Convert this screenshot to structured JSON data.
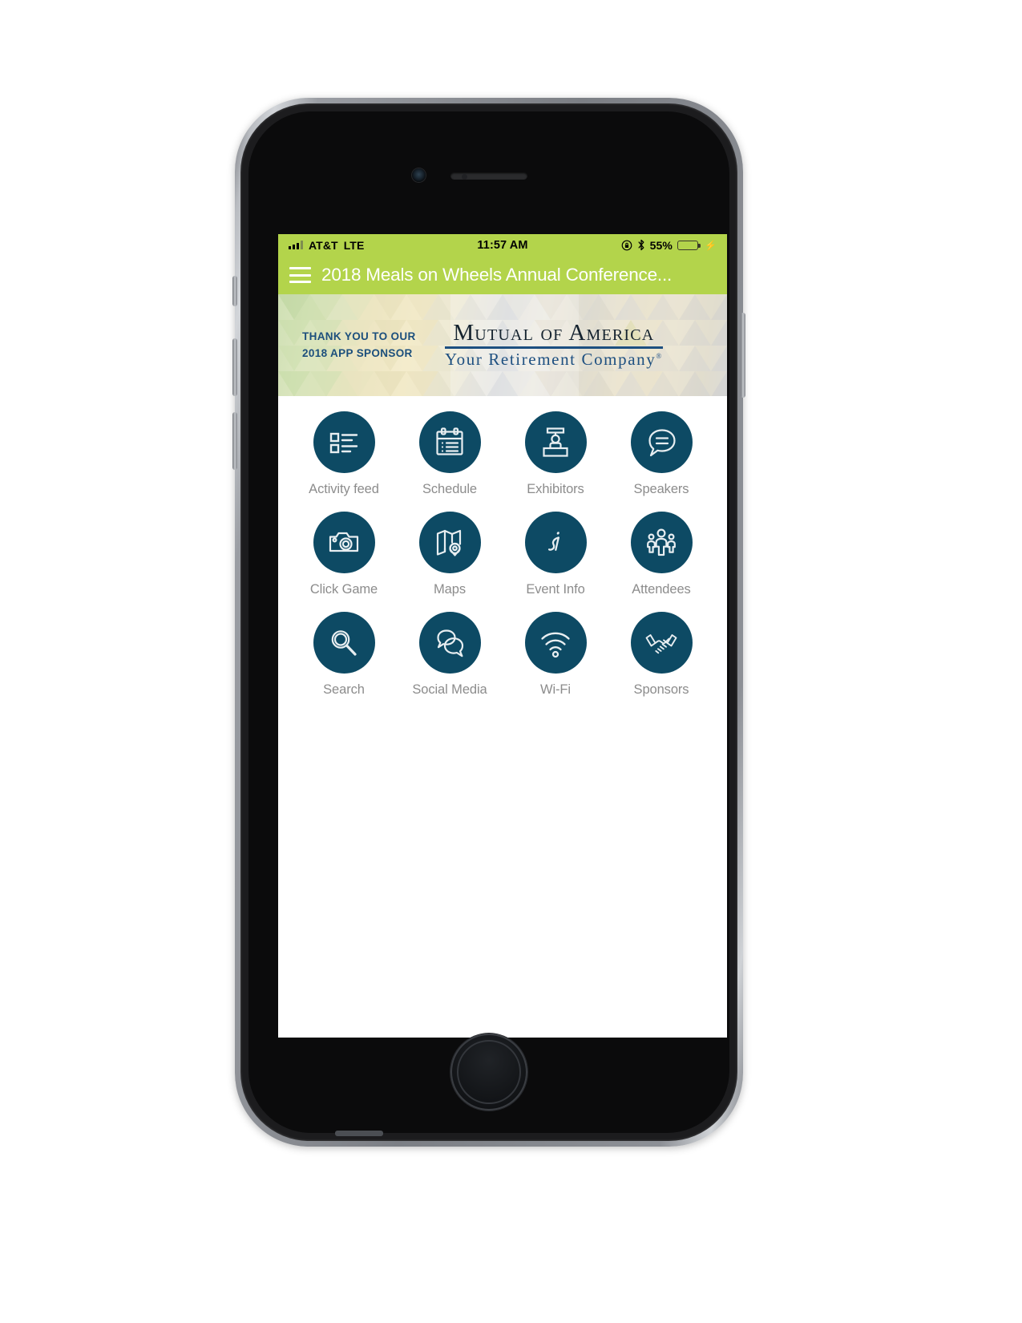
{
  "status_bar": {
    "carrier": "AT&T",
    "network": "LTE",
    "time": "11:57 AM",
    "battery_percent": "55%",
    "icons": [
      "signal-bars-icon",
      "rotation-lock-icon",
      "bluetooth-icon",
      "battery-icon",
      "charging-bolt-icon"
    ]
  },
  "nav": {
    "menu_icon": "hamburger-menu-icon",
    "title": "2018 Meals on Wheels Annual Conference..."
  },
  "banner": {
    "thank_you_line1": "THANK YOU TO OUR",
    "thank_you_line2": "2018 APP SPONSOR",
    "sponsor_name": "Mutual of America",
    "sponsor_tagline": "Your Retirement Company",
    "sponsor_trademark": "®"
  },
  "grid": {
    "items": [
      {
        "label": "Activity feed",
        "icon": "activity-feed-icon"
      },
      {
        "label": "Schedule",
        "icon": "calendar-icon"
      },
      {
        "label": "Exhibitors",
        "icon": "exhibitor-booth-icon"
      },
      {
        "label": "Speakers",
        "icon": "speech-bubble-icon"
      },
      {
        "label": "Click Game",
        "icon": "camera-icon"
      },
      {
        "label": "Maps",
        "icon": "map-pin-icon"
      },
      {
        "label": "Event Info",
        "icon": "info-italic-icon"
      },
      {
        "label": "Attendees",
        "icon": "people-group-icon"
      },
      {
        "label": "Search",
        "icon": "magnifier-icon"
      },
      {
        "label": "Social Media",
        "icon": "chat-bubbles-icon"
      },
      {
        "label": "Wi-Fi",
        "icon": "wifi-icon"
      },
      {
        "label": "Sponsors",
        "icon": "handshake-icon"
      }
    ]
  },
  "colors": {
    "brand_green": "#b3d44b",
    "icon_teal": "#0d4a64",
    "label_gray": "#8c8c8c",
    "sponsor_blue": "#1d4f80",
    "battery_yellow": "#f7c815"
  }
}
